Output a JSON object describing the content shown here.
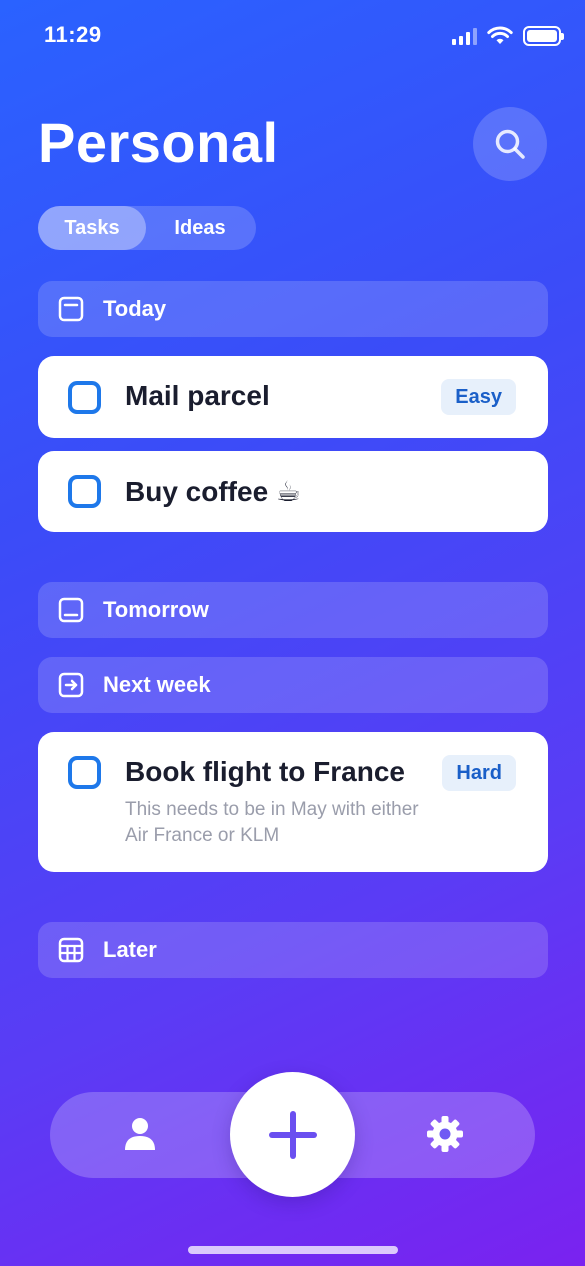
{
  "status": {
    "time": "11:29"
  },
  "header": {
    "title": "Personal",
    "search_icon": "search-icon"
  },
  "tabs": [
    {
      "label": "Tasks",
      "active": true
    },
    {
      "label": "Ideas",
      "active": false
    }
  ],
  "sections": {
    "today": {
      "label": "Today",
      "icon": "calendar-icon"
    },
    "tomorrow": {
      "label": "Tomorrow",
      "icon": "calendar-tomorrow-icon"
    },
    "next_week": {
      "label": "Next week",
      "icon": "arrow-right-box-icon"
    },
    "later": {
      "label": "Later",
      "icon": "calendar-grid-icon"
    }
  },
  "tasks": [
    {
      "title": "Mail parcel",
      "badge": "Easy",
      "note": ""
    },
    {
      "title": "Buy coffee ☕",
      "badge": "",
      "note": ""
    },
    {
      "title": "Book flight to France",
      "badge": "Hard",
      "note": "This needs to be in May with either Air France or KLM"
    }
  ],
  "nav": {
    "profile_icon": "person-icon",
    "add_icon": "plus-icon",
    "settings_icon": "gear-icon"
  },
  "colors": {
    "accent": "#1e78ea",
    "add_button_plus": "#6a4ff0",
    "badge_bg": "#e7f0fb",
    "badge_text": "#1a5fc8"
  }
}
